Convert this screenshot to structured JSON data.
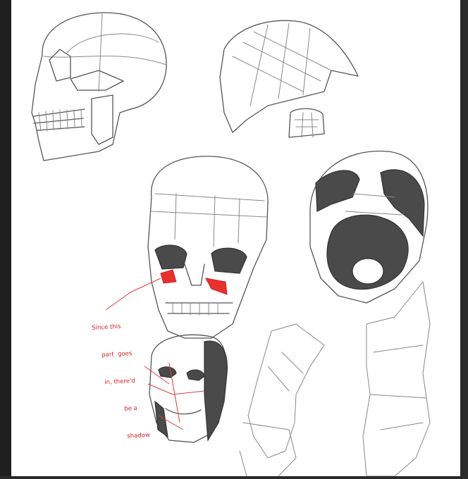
{
  "annotation": {
    "lines": [
      "Since this",
      "part  goes",
      "in, there'd",
      "be a",
      "shadow"
    ]
  },
  "colors": {
    "sketch": "#555555",
    "shade": "#4a4a4a",
    "annotation": "#e23b3b",
    "frame": "#1f1f1f",
    "paper": "#ffffff"
  }
}
